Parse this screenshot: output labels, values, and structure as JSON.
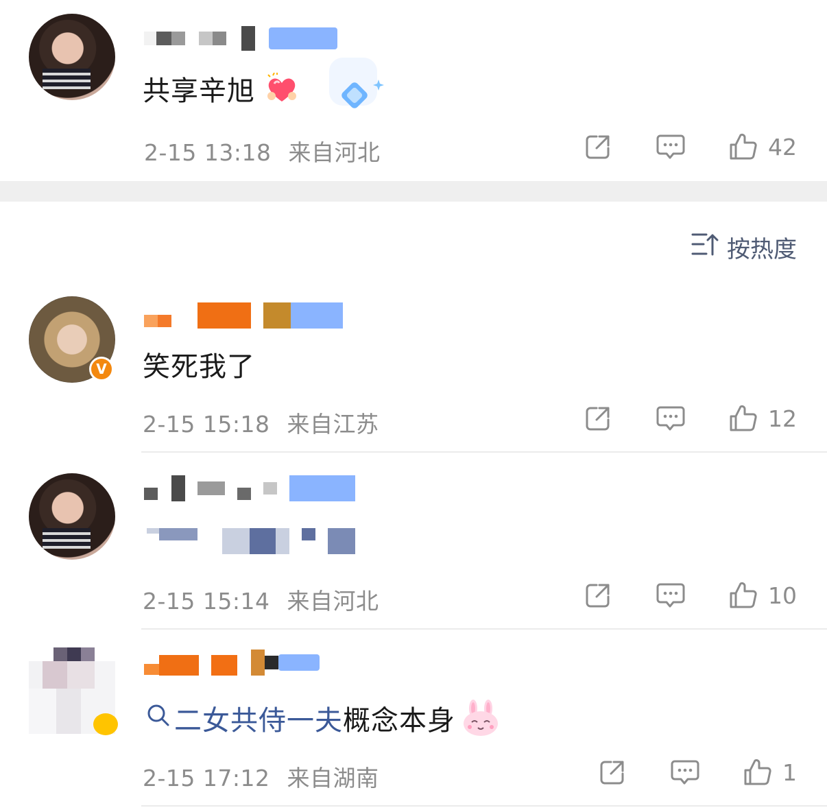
{
  "comments": [
    {
      "text": "共享辛旭",
      "emoji": "heart-hands",
      "time": "2-15 13:18",
      "location": "来自河北",
      "likes": "42"
    },
    {
      "text": "笑死我了",
      "time": "2-15 15:18",
      "location": "来自江苏",
      "likes": "12",
      "verified": "V"
    },
    {
      "text": "",
      "time": "2-15 15:14",
      "location": "来自河北",
      "likes": "10"
    },
    {
      "search_link": "二女共侍一夫",
      "text": "概念本身",
      "time": "2-15 17:12",
      "location": "来自湖南",
      "likes": "1"
    }
  ],
  "sort": {
    "label": "按热度"
  },
  "colors": {
    "meta_gray": "#8c8c8c",
    "link_blue": "#3b5998",
    "verified_orange": "#f3880f",
    "divider": "#ebebeb"
  }
}
